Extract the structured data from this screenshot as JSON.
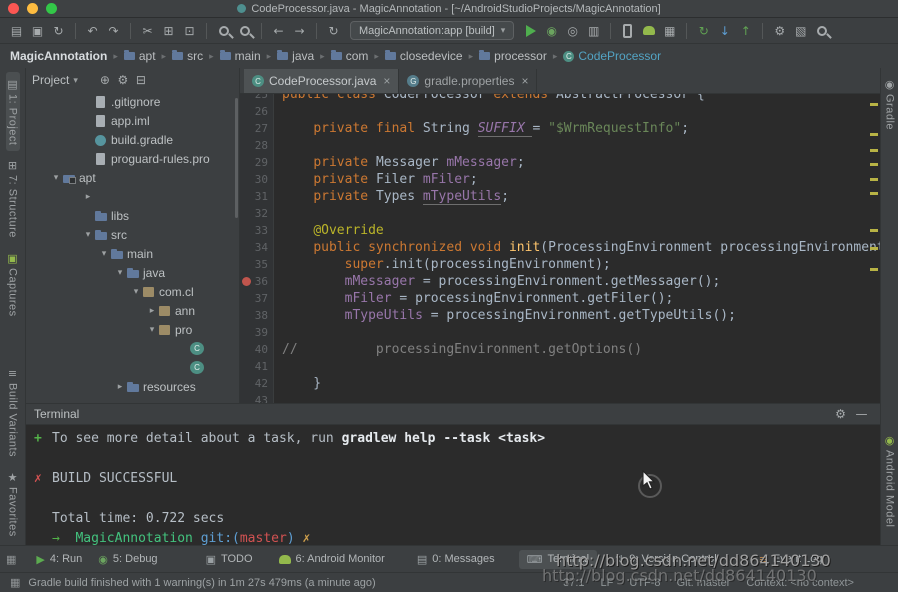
{
  "titlebar": {
    "title": "CodeProcessor.java - MagicAnnotation - [~/AndroidStudioProjects/MagicAnnotation]"
  },
  "toolbar": {
    "run_config_label": "MagicAnnotation:app [build]",
    "left_groups": [
      [
        {
          "name": "open-icon",
          "glyph": "▤"
        },
        {
          "name": "save-all-icon",
          "glyph": "▣"
        },
        {
          "name": "sync-icon",
          "glyph": "↻"
        }
      ],
      [
        {
          "name": "undo-icon",
          "glyph": "↶"
        },
        {
          "name": "redo-icon",
          "glyph": "↷"
        }
      ],
      [
        {
          "name": "cut-icon",
          "glyph": "✂"
        },
        {
          "name": "copy-icon",
          "glyph": "⊞"
        },
        {
          "name": "paste-icon",
          "glyph": "⊡"
        }
      ],
      [
        {
          "name": "find-icon",
          "shape": "search"
        },
        {
          "name": "replace-icon",
          "shape": "search"
        }
      ],
      [
        {
          "name": "back-icon",
          "glyph": "←"
        },
        {
          "name": "forward-icon",
          "glyph": "→"
        }
      ],
      [
        {
          "name": "gradle-make-icon",
          "glyph": "↻"
        }
      ]
    ],
    "right_groups": [
      [
        {
          "name": "run-icon",
          "shape": "play"
        },
        {
          "name": "debug-icon",
          "glyph": "◉",
          "color": "#6ba45f"
        },
        {
          "name": "coverage-icon",
          "glyph": "◎"
        },
        {
          "name": "profile-icon",
          "glyph": "▥"
        }
      ],
      [
        {
          "name": "avd-manager-icon",
          "shape": "phone"
        },
        {
          "name": "sdk-manager-icon",
          "shape": "android"
        },
        {
          "name": "monitor-icon",
          "glyph": "▦"
        }
      ],
      [
        {
          "name": "gradle-sync-icon",
          "glyph": "↻",
          "color": "#61a353"
        },
        {
          "name": "vcs-update-icon",
          "glyph": "↓",
          "color": "#5e9fd4"
        },
        {
          "name": "vcs-commit-icon",
          "glyph": "↑",
          "color": "#61a353"
        }
      ],
      [
        {
          "name": "settings-icon",
          "glyph": "⚙"
        },
        {
          "name": "project-structure-icon",
          "glyph": "▧"
        },
        {
          "name": "search-everywhere-icon",
          "shape": "search"
        }
      ]
    ]
  },
  "breadcrumbs": {
    "items": [
      {
        "label": "MagicAnnotation",
        "icon": "none",
        "bold": true
      },
      {
        "label": "apt",
        "icon": "folder"
      },
      {
        "label": "src",
        "icon": "folder"
      },
      {
        "label": "main",
        "icon": "folder"
      },
      {
        "label": "java",
        "icon": "folder"
      },
      {
        "label": "com",
        "icon": "folder"
      },
      {
        "label": "closedevice",
        "icon": "folder"
      },
      {
        "label": "processor",
        "icon": "folder"
      },
      {
        "label": "CodeProcessor",
        "icon": "class",
        "accent": true
      }
    ]
  },
  "project": {
    "header_title": "Project",
    "header_icons": [
      {
        "name": "view-options-icon",
        "glyph": "⊕"
      },
      {
        "name": "settings-icon",
        "glyph": "⚙"
      },
      {
        "name": "collapse-all-icon",
        "glyph": "⊟"
      }
    ],
    "tree": [
      {
        "label": ".gitignore",
        "icon": "file",
        "indent": 3,
        "arrow": ""
      },
      {
        "label": "app.iml",
        "icon": "file",
        "indent": 3,
        "arrow": ""
      },
      {
        "label": "build.gradle",
        "icon": "gradle",
        "indent": 3,
        "arrow": ""
      },
      {
        "label": "proguard-rules.pro",
        "icon": "file",
        "indent": 3,
        "arrow": ""
      },
      {
        "label": "apt",
        "icon": "module",
        "indent": 1,
        "arrow": "expanded"
      },
      {
        "label": "",
        "icon": "none",
        "indent": 3,
        "arrow": "collapsed"
      },
      {
        "label": "libs",
        "icon": "folder",
        "indent": 3,
        "arrow": ""
      },
      {
        "label": "src",
        "icon": "folder",
        "indent": 3,
        "arrow": "expanded"
      },
      {
        "label": "main",
        "icon": "folder",
        "indent": 4,
        "arrow": "expanded"
      },
      {
        "label": "java",
        "icon": "folder",
        "indent": 5,
        "arrow": "expanded"
      },
      {
        "label": "com.cl",
        "icon": "package",
        "indent": 6,
        "arrow": "expanded"
      },
      {
        "label": "ann",
        "icon": "package",
        "indent": 7,
        "arrow": "collapsed"
      },
      {
        "label": "pro",
        "icon": "package",
        "indent": 7,
        "arrow": "expanded"
      },
      {
        "label": "",
        "icon": "class",
        "indent": 9,
        "arrow": ""
      },
      {
        "label": "",
        "icon": "class",
        "indent": 9,
        "arrow": ""
      },
      {
        "label": "resources",
        "icon": "folder",
        "indent": 5,
        "arrow": "collapsed"
      }
    ]
  },
  "editor": {
    "tabs": [
      {
        "label": "CodeProcessor.java",
        "icon": "class",
        "active": true
      },
      {
        "label": "gradle.properties",
        "icon": "gradle",
        "active": false
      }
    ],
    "breakpoint_line": 36,
    "stripe_marks": [
      9,
      39,
      55,
      69,
      84,
      98,
      135,
      153,
      174
    ],
    "lines": [
      {
        "n": 25,
        "t": [
          [
            "public class ",
            "k"
          ],
          [
            "CodeProcessor ",
            "d"
          ],
          [
            "extends ",
            "k"
          ],
          [
            "AbstractProcessor {",
            "d"
          ]
        ]
      },
      {
        "n": 26,
        "t": []
      },
      {
        "n": 27,
        "t": [
          [
            "    ",
            "d"
          ],
          [
            "private final ",
            "k"
          ],
          [
            "String ",
            "d"
          ],
          [
            "SUFFIX ",
            "cf"
          ],
          [
            "= ",
            "d"
          ],
          [
            "\"$WrmRequestInfo\"",
            "s"
          ],
          [
            ";",
            "d"
          ]
        ]
      },
      {
        "n": 28,
        "t": []
      },
      {
        "n": 29,
        "t": [
          [
            "    ",
            "d"
          ],
          [
            "private ",
            "k"
          ],
          [
            "Messager ",
            "d"
          ],
          [
            "mMessager",
            "f"
          ],
          [
            ";",
            "d"
          ]
        ]
      },
      {
        "n": 30,
        "t": [
          [
            "    ",
            "d"
          ],
          [
            "private ",
            "k"
          ],
          [
            "Filer ",
            "d"
          ],
          [
            "mFiler",
            "f"
          ],
          [
            ";",
            "d"
          ]
        ]
      },
      {
        "n": 31,
        "t": [
          [
            "    ",
            "d"
          ],
          [
            "private ",
            "k"
          ],
          [
            "Types ",
            "d"
          ],
          [
            "mTypeUtils",
            "fu"
          ],
          [
            ";",
            "d"
          ]
        ]
      },
      {
        "n": 32,
        "t": []
      },
      {
        "n": 33,
        "t": [
          [
            "    ",
            "d"
          ],
          [
            "@Override",
            "a"
          ]
        ]
      },
      {
        "n": 34,
        "t": [
          [
            "    ",
            "d"
          ],
          [
            "public synchronized void ",
            "k"
          ],
          [
            "init",
            "m"
          ],
          [
            "(ProcessingEnvironment processingEnvironment) {",
            "d"
          ]
        ]
      },
      {
        "n": 35,
        "t": [
          [
            "        ",
            "d"
          ],
          [
            "super",
            "k"
          ],
          [
            ".init(processingEnvironment);",
            "d"
          ]
        ]
      },
      {
        "n": 36,
        "t": [
          [
            "        ",
            "d"
          ],
          [
            "mMessager ",
            "f"
          ],
          [
            "= processingEnvironment.getMessager();",
            "d"
          ]
        ]
      },
      {
        "n": 37,
        "t": [
          [
            "        ",
            "d"
          ],
          [
            "mFiler ",
            "f"
          ],
          [
            "= processingEnvironment.getFiler();",
            "d"
          ]
        ]
      },
      {
        "n": 38,
        "t": [
          [
            "        ",
            "d"
          ],
          [
            "mTypeUtils ",
            "f"
          ],
          [
            "= processingEnvironment.getTypeUtils();",
            "d"
          ]
        ]
      },
      {
        "n": 39,
        "t": []
      },
      {
        "n": 40,
        "t": [
          [
            "//          processingEnvironment.getOptions()",
            "cm"
          ]
        ]
      },
      {
        "n": 41,
        "t": []
      },
      {
        "n": 42,
        "t": [
          [
            "    }",
            "d"
          ]
        ]
      },
      {
        "n": 43,
        "t": []
      }
    ]
  },
  "terminal": {
    "title": "Terminal",
    "header_icons": [
      {
        "name": "terminal-settings-icon",
        "glyph": "⚙"
      },
      {
        "name": "hide-panel-icon",
        "glyph": "—"
      }
    ],
    "lines": [
      {
        "mark": "+",
        "markClass": "g",
        "tokens": [
          [
            "To see more detail about a task, run ",
            "d"
          ],
          [
            "gradlew help --task <task>",
            "w"
          ]
        ]
      },
      {
        "tokens": []
      },
      {
        "mark": "✗",
        "markClass": "r",
        "tokens": [
          [
            "BUILD SUCCESSFUL",
            "d"
          ]
        ]
      },
      {
        "tokens": []
      },
      {
        "tokens": [
          [
            "Total time: 0.722 secs",
            "d"
          ]
        ]
      },
      {
        "tokens": [
          [
            "→  ",
            "g"
          ],
          [
            "MagicAnnotation ",
            "c"
          ],
          [
            "git:(",
            "b"
          ],
          [
            "master",
            "r"
          ],
          [
            ") ",
            "b"
          ],
          [
            "✗",
            "y"
          ]
        ]
      }
    ]
  },
  "bottombar": {
    "items": [
      {
        "label": "4: Run",
        "glyph": "▶",
        "color": "#5cab50"
      },
      {
        "label": "5: Debug",
        "glyph": "◉",
        "color": "#6ba45f"
      },
      {
        "label": "TODO",
        "glyph": "▣"
      },
      {
        "label": "6: Android Monitor",
        "shape": "android"
      },
      {
        "label": "0: Messages",
        "glyph": "▤"
      },
      {
        "label": "Terminal",
        "glyph": "⌨",
        "active": true
      },
      {
        "label": "9: Version Control",
        "glyph": "⇅"
      },
      {
        "label": "Event Log",
        "glyph": "≡",
        "color": "#c08a50"
      }
    ]
  },
  "statusbar": {
    "message": "Gradle build finished with 1 warning(s) in 1m 27s 479ms (a minute ago)",
    "widgets": [
      {
        "name": "caret-position",
        "text": "37:1"
      },
      {
        "name": "line-separator",
        "text": "LF"
      },
      {
        "name": "encoding",
        "text": "UTF-8"
      },
      {
        "name": "git-branch",
        "text": "Git: master"
      },
      {
        "name": "context",
        "text": "Context: <no context>"
      }
    ]
  },
  "stripes": {
    "left_top": [
      {
        "label": "1: Project",
        "glyph": "▤",
        "active": true
      },
      {
        "label": "7: Structure",
        "glyph": "⊞"
      },
      {
        "label": "Captures",
        "glyph": "▣",
        "color": "#93b94c"
      }
    ],
    "left_bottom": [
      {
        "label": "Build Variants",
        "glyph": "≡"
      },
      {
        "label": "Favorites",
        "glyph": "★"
      }
    ],
    "right": [
      {
        "label": "Gradle",
        "glyph": "◉"
      },
      {
        "label": "Android Model",
        "glyph": "◉",
        "color": "#93b94c",
        "gap": 290
      }
    ]
  },
  "watermark": {
    "text": "http://blog.csdn.net/dd864140130"
  }
}
